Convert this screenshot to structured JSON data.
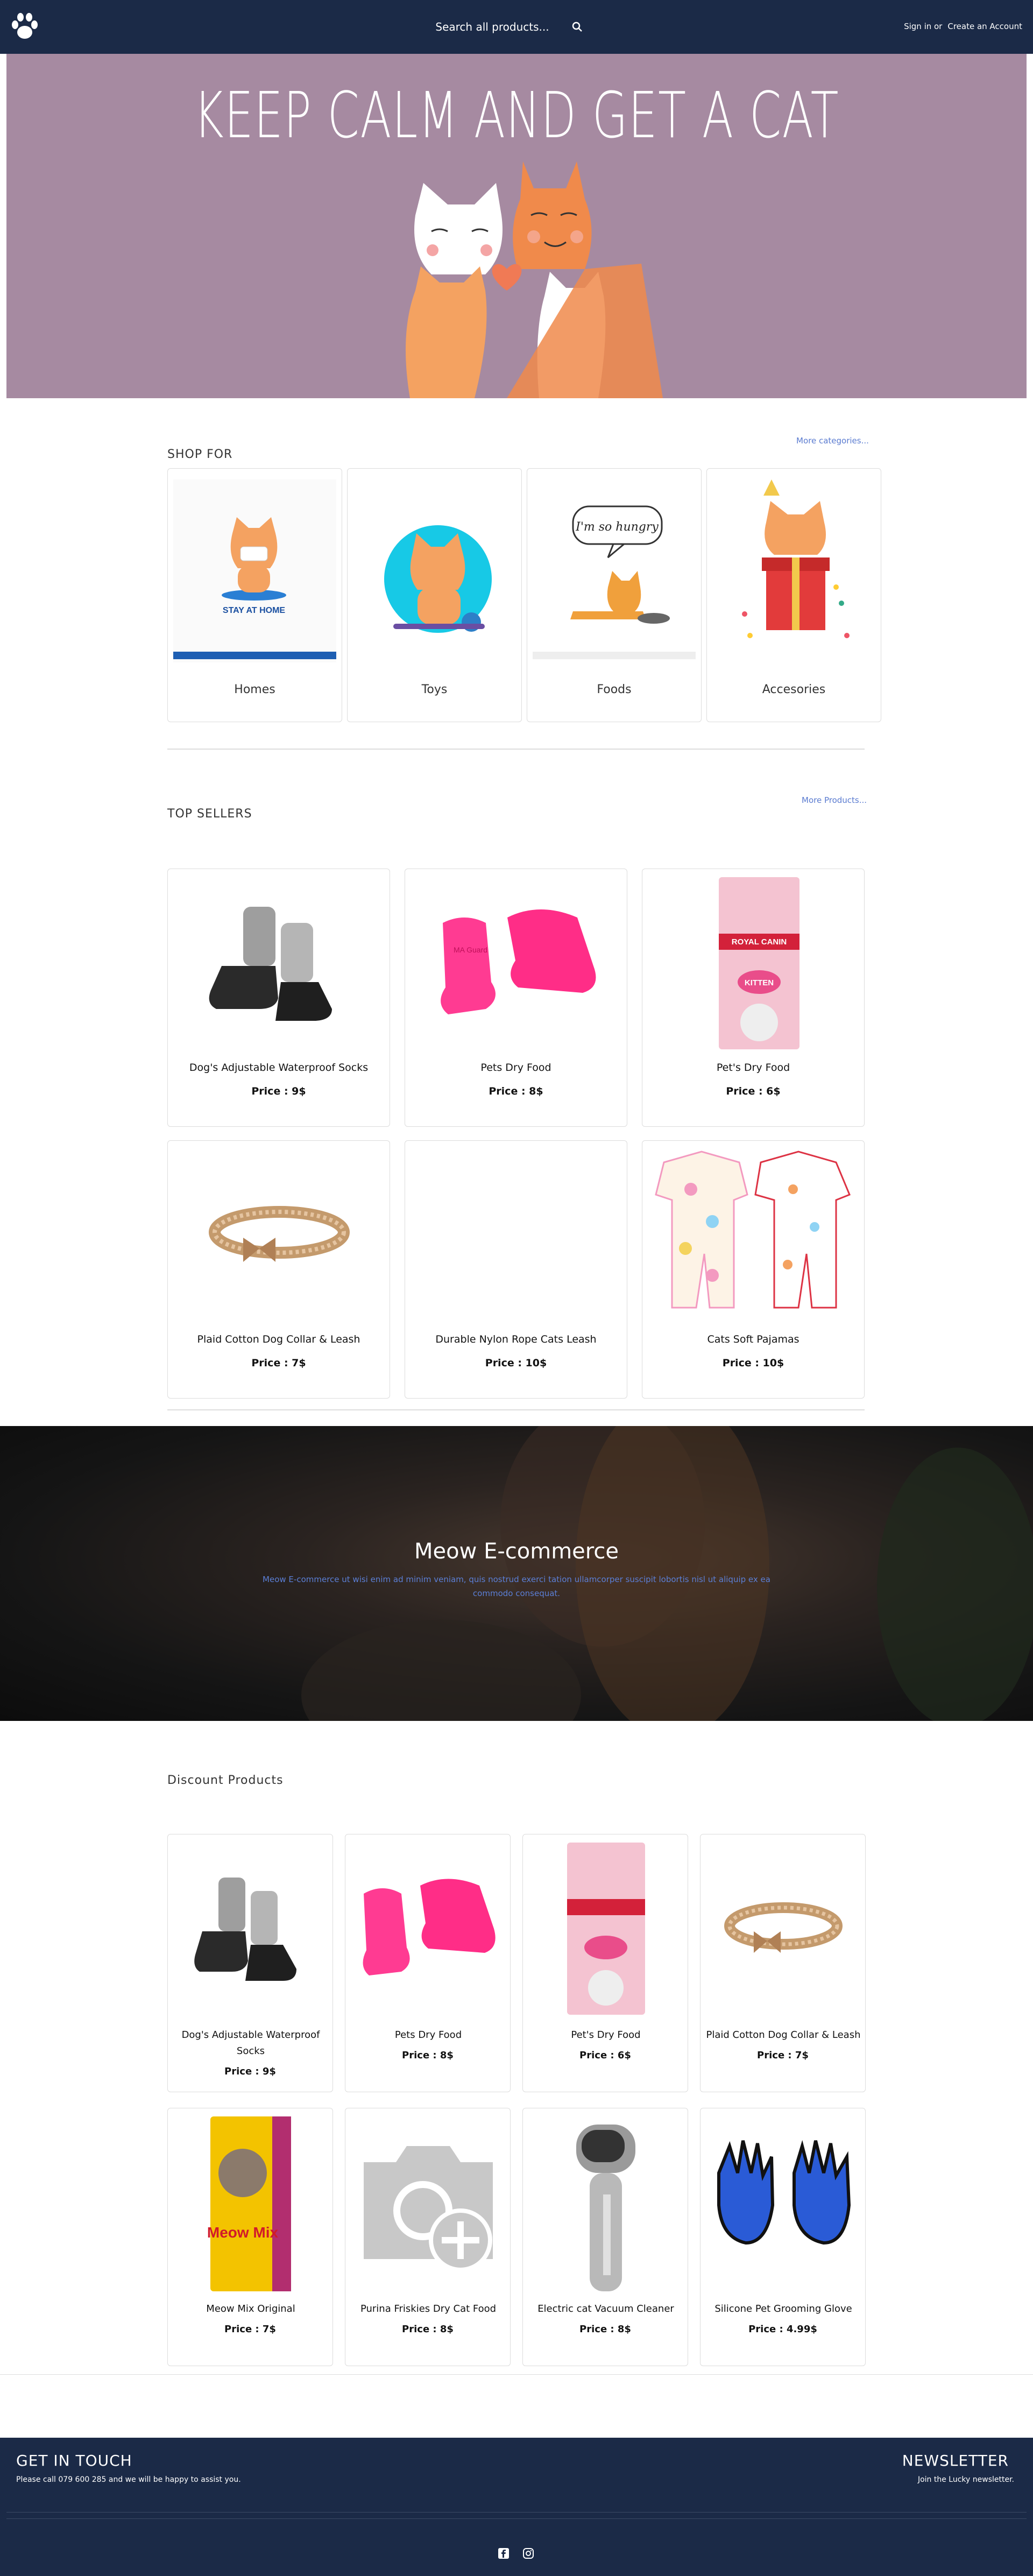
{
  "header": {
    "search_placeholder": "Search all products...",
    "sign_in": "Sign in or",
    "create_account": "Create an Account"
  },
  "hero": {
    "title": "KEEP CALM AND GET A CAT"
  },
  "shop_for": {
    "title": "SHOP FOR",
    "more": "More categories...",
    "categories": [
      {
        "label": "Homes",
        "icon": "cat-stay-at-home-illustration"
      },
      {
        "label": "Toys",
        "icon": "cat-with-yarn-illustration"
      },
      {
        "label": "Foods",
        "icon": "hungry-cat-illustration"
      },
      {
        "label": "Accesories",
        "icon": "cat-in-gift-box-illustration"
      }
    ],
    "homes_caption": "STAY AT HOME",
    "foods_caption": "I'm so hungry"
  },
  "top_sellers": {
    "title": "TOP SELLERS",
    "more": "More Products...",
    "products": [
      {
        "name": "Dog's Adjustable Waterproof Socks",
        "price": "Price : 9$"
      },
      {
        "name": "Pets Dry Food",
        "price": "Price : 8$"
      },
      {
        "name": "Pet's Dry Food",
        "price": "Price : 6$"
      },
      {
        "name": "Plaid Cotton Dog Collar & Leash",
        "price": "Price : 7$"
      },
      {
        "name": "Durable Nylon Rope Cats Leash",
        "price": "Price : 10$"
      },
      {
        "name": "Cats Soft Pajamas",
        "price": "Price : 10$"
      }
    ]
  },
  "banner": {
    "title": "Meow E-commerce",
    "text": "Meow E-commerce ut wisi enim ad minim veniam, quis nostrud exerci tation ullamcorper suscipit lobortis nisl ut aliquip ex ea commodo consequat."
  },
  "discount": {
    "title": "Discount Products",
    "products": [
      {
        "name": "Dog's Adjustable Waterproof Socks",
        "price": "Price : 9$"
      },
      {
        "name": "Pets Dry Food",
        "price": "Price : 8$"
      },
      {
        "name": "Pet's Dry Food",
        "price": "Price : 6$"
      },
      {
        "name": "Plaid Cotton Dog Collar & Leash",
        "price": "Price : 7$"
      },
      {
        "name": "Meow Mix Original",
        "price": "Price : 7$"
      },
      {
        "name": "Purina Friskies Dry Cat Food",
        "price": "Price : 8$"
      },
      {
        "name": "Electric cat Vacuum Cleaner",
        "price": "Price : 8$"
      },
      {
        "name": "Silicone Pet Grooming Glove",
        "price": "Price : 4.99$"
      }
    ]
  },
  "footer": {
    "get_in_touch": "GET IN TOUCH",
    "contact_text": "Please call 079 600 285 and we will be happy to assist you.",
    "newsletter": "NEWSLETTER",
    "newsletter_text": "Join the Lucky newsletter."
  },
  "brand_text": {
    "royal_canin": "ROYAL CANIN",
    "kitten": "KITTEN",
    "meow_mix": "Meow Mix",
    "boots_brand": "MA Guard"
  },
  "colors": {
    "header_bg": "#1b2a47",
    "hero_bg": "#a68aa1",
    "link": "#5a7bd0"
  }
}
